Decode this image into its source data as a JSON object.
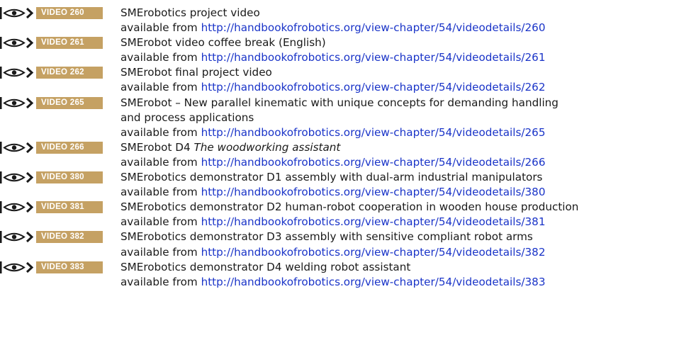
{
  "colors": {
    "badge_background": "#c5a163",
    "badge_text": "#ffffff",
    "link": "#1a34c8",
    "text": "#1a1a1a"
  },
  "icons": {
    "badge_icon": "eye-icon"
  },
  "videos": [
    {
      "badge": "VIDEO 260",
      "title": "SMErobotics project video",
      "title_emphasis": "",
      "available_prefix": "available from",
      "url": "http://handbookofrobotics.org/view-chapter/54/videodetails/260"
    },
    {
      "badge": "VIDEO 261",
      "title": "SMErobot video coffee break (English)",
      "title_emphasis": "",
      "available_prefix": "available from",
      "url": "http://handbookofrobotics.org/view-chapter/54/videodetails/261"
    },
    {
      "badge": "VIDEO 262",
      "title": "SMErobot final project video",
      "title_emphasis": "",
      "available_prefix": "available from",
      "url": "http://handbookofrobotics.org/view-chapter/54/videodetails/262"
    },
    {
      "badge": "VIDEO 265",
      "title": "SMErobot – New parallel kinematic with unique concepts for demanding handling and process applications",
      "title_emphasis": "",
      "available_prefix": "available from",
      "url": "http://handbookofrobotics.org/view-chapter/54/videodetails/265"
    },
    {
      "badge": "VIDEO 266",
      "title": "SMErobot D4",
      "title_emphasis": "The woodworking assistant",
      "available_prefix": "available from",
      "url": "http://handbookofrobotics.org/view-chapter/54/videodetails/266"
    },
    {
      "badge": "VIDEO 380",
      "title": "SMErobotics demonstrator D1 assembly with dual-arm industrial manipulators",
      "title_emphasis": "",
      "available_prefix": "available from",
      "url": "http://handbookofrobotics.org/view-chapter/54/videodetails/380"
    },
    {
      "badge": "VIDEO 381",
      "title": "SMErobotics demonstrator D2 human-robot cooperation in wooden house production",
      "title_emphasis": "",
      "available_prefix": "available from",
      "url": "http://handbookofrobotics.org/view-chapter/54/videodetails/381"
    },
    {
      "badge": "VIDEO 382",
      "title": "SMErobotics demonstrator D3 assembly with sensitive compliant robot arms",
      "title_emphasis": "",
      "available_prefix": "available from",
      "url": "http://handbookofrobotics.org/view-chapter/54/videodetails/382"
    },
    {
      "badge": "VIDEO 383",
      "title": "SMErobotics demonstrator D4 welding robot assistant",
      "title_emphasis": "",
      "available_prefix": "available from",
      "url": "http://handbookofrobotics.org/view-chapter/54/videodetails/383"
    }
  ]
}
